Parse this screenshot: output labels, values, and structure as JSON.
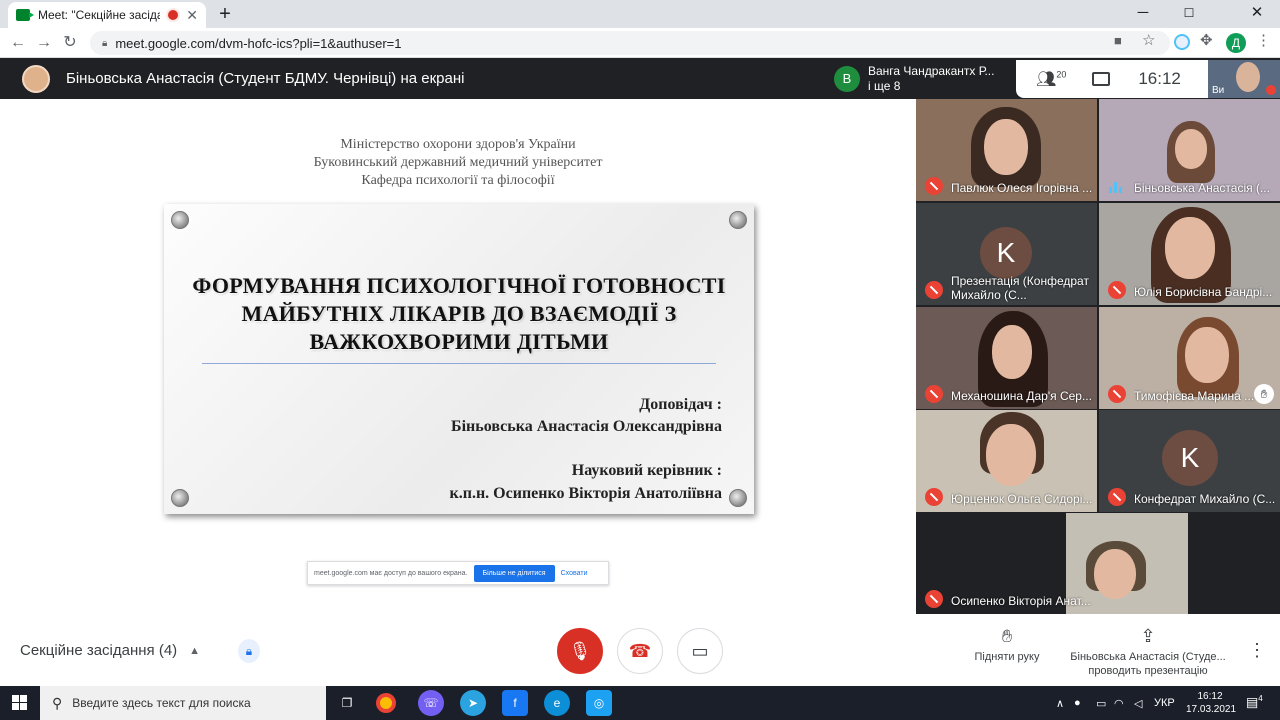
{
  "browser": {
    "tab_title": "Meet: \"Секційне засідання (",
    "tab_close": "✕",
    "new_tab": "+",
    "url": "meet.google.com/dvm-hofc-ics?pli=1&authuser=1",
    "profile_initial": "Д",
    "window": {
      "minimize": "─",
      "maximize": "☐",
      "close": "✕"
    }
  },
  "meet": {
    "presenter_banner": "Біньовська Анастасія (Студент БДМУ. Чернівці) на екрані",
    "chat_preview": {
      "initial": "B",
      "line1": "Ванга Чандракантх Р...",
      "line2": "і ще 8"
    },
    "participants_count": "20",
    "clock": "16:12",
    "self_label": "Ви",
    "meeting_title": "Секційне засідання (4)",
    "raise_hand": "Підняти руку",
    "presenting_line1": "Біньовська Анастасія (Студе...",
    "presenting_line2": "проводить презентацію"
  },
  "slide": {
    "ministry": [
      "Міністерство охорони здоров'я  України",
      "Буковинський  державний медичний університет",
      "Кафедра психології та філософії"
    ],
    "title": [
      "ФОРМУВАННЯ ПСИХОЛОГІЧНОЇ ГОТОВНОСТІ",
      "МАЙБУТНІХ ЛІКАРІВ ДО ВЗАЄМОДІЇ З",
      "ВАЖКОХВОРИМИ ДІТЬМИ"
    ],
    "speaker_label": "Доповідач :",
    "speaker_name": "Біньовська Анастасія Олександрівна",
    "advisor_label": "Науковий керівник :",
    "advisor_name": "к.п.н. Осипенко Вікторія Анатоліївна"
  },
  "share_bar": {
    "text": "meet.google.com має доступ до вашого екрана.",
    "stop": "Більше не ділитися",
    "hide": "Сховати"
  },
  "tiles": [
    {
      "name": "Павлюк Олеся Ігорівна ...",
      "mic": "muted"
    },
    {
      "name": "Біньовська Анастасія (...",
      "mic": "speaking"
    },
    {
      "name": "Презентація (Конфедрат Михайло (С...",
      "initial": "K",
      "mic": "muted"
    },
    {
      "name": "Юлія Борисівна Бандрі...",
      "mic": "muted"
    },
    {
      "name": "Механошина Дар'я Сер...",
      "mic": "muted"
    },
    {
      "name": "Тимофієва Марина ...",
      "mic": "muted",
      "hand": true
    },
    {
      "name": "Юрценюк Ольга Сидорі...",
      "mic": "muted"
    },
    {
      "name": "Конфедрат Михайло (С...",
      "initial": "K",
      "mic": "muted"
    },
    {
      "name": "Осипенко Вікторія Анат...",
      "mic": "muted"
    }
  ],
  "taskbar": {
    "search_placeholder": "Введите здесь текст для поиска",
    "lang": "УКР",
    "time": "16:12",
    "date": "17.03.2021",
    "notif_count": "4"
  },
  "colors": {
    "meet_dark": "#202124",
    "muted_red": "#ea4335",
    "hangup_red": "#d93025",
    "accent_blue": "#1a73e8"
  }
}
